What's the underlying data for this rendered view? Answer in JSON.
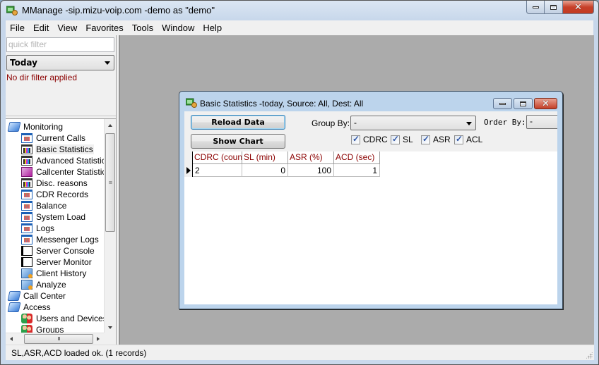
{
  "window": {
    "title": "MManage -sip.mizu-voip.com -demo as \"demo\"",
    "caption_buttons": {
      "minimize": "minimize",
      "maximize": "maximize",
      "close": "✕"
    }
  },
  "menubar": {
    "items": [
      "File",
      "Edit",
      "View",
      "Favorites",
      "Tools",
      "Window",
      "Help"
    ]
  },
  "left_panel": {
    "quick_filter": {
      "value": "",
      "placeholder": "quick filter"
    },
    "period_select": {
      "selected": "Today"
    },
    "dir_filter_text": "No dir filter applied",
    "tree": [
      {
        "label": "Monitoring",
        "icon": "folder-icon",
        "level": 0,
        "selected": false
      },
      {
        "label": "Current Calls",
        "icon": "grid-icon",
        "level": 1,
        "selected": false
      },
      {
        "label": "Basic Statistics",
        "icon": "chart-icon",
        "level": 1,
        "selected": true
      },
      {
        "label": "Advanced Statistics",
        "icon": "chart-icon",
        "level": 1,
        "selected": false
      },
      {
        "label": "Callcenter Statistics",
        "icon": "callcenter-icon",
        "level": 1,
        "selected": false
      },
      {
        "label": "Disc. reasons",
        "icon": "chart-icon",
        "level": 1,
        "selected": false
      },
      {
        "label": "CDR Records",
        "icon": "grid-icon",
        "level": 1,
        "selected": false
      },
      {
        "label": "Balance",
        "icon": "grid-icon",
        "level": 1,
        "selected": false
      },
      {
        "label": "System Load",
        "icon": "grid-icon",
        "level": 1,
        "selected": false
      },
      {
        "label": "Logs",
        "icon": "grid-icon",
        "level": 1,
        "selected": false
      },
      {
        "label": "Messenger Logs",
        "icon": "grid-icon",
        "level": 1,
        "selected": false
      },
      {
        "label": "Server Console",
        "icon": "console-icon",
        "level": 1,
        "selected": false
      },
      {
        "label": "Server Monitor",
        "icon": "console-icon",
        "level": 1,
        "selected": false
      },
      {
        "label": "Client History",
        "icon": "history-icon",
        "level": 1,
        "selected": false
      },
      {
        "label": "Analyze",
        "icon": "history-icon",
        "level": 1,
        "selected": false
      },
      {
        "label": "Call Center",
        "icon": "folder-icon",
        "level": 0,
        "selected": false
      },
      {
        "label": "Access",
        "icon": "folder-icon",
        "level": 0,
        "selected": false
      },
      {
        "label": "Users and Devices",
        "icon": "users-icon",
        "level": 1,
        "selected": false
      },
      {
        "label": "Groups",
        "icon": "users-icon",
        "level": 1,
        "selected": false
      }
    ],
    "hscroll_grip": "III"
  },
  "child_window": {
    "title": "Basic Statistics -today, Source: All, Dest: All",
    "caption_buttons": {
      "close": "✕"
    },
    "reload_button": "Reload Data",
    "show_chart_button": "Show Chart",
    "group_by": {
      "label": "Group By:",
      "selected": "-"
    },
    "order_by": {
      "label": "Order By:",
      "selected": "-"
    },
    "checkboxes": [
      {
        "label": "CDRC",
        "checked": true
      },
      {
        "label": "SL",
        "checked": true
      },
      {
        "label": "ASR",
        "checked": true
      },
      {
        "label": "ACL",
        "checked": true
      }
    ],
    "grid": {
      "columns": [
        "CDRC (count)",
        "SL (min)",
        "ASR (%)",
        "ACD (sec)"
      ],
      "rows": [
        [
          "2",
          "0",
          "100",
          "1"
        ]
      ]
    }
  },
  "statusbar": {
    "text": "SL,ASR,ACD loaded ok. (1 records)"
  }
}
